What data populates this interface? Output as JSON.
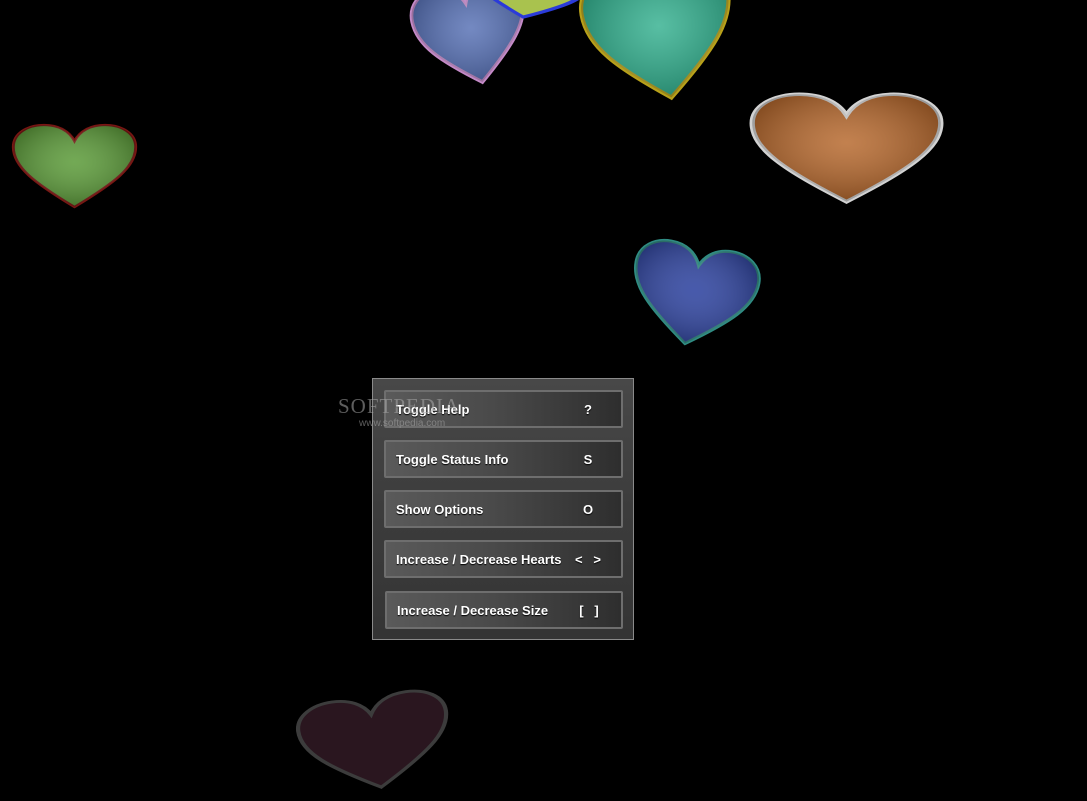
{
  "background_color": "#000000",
  "help_menu": {
    "items": [
      {
        "label": "Toggle Help",
        "key": "?"
      },
      {
        "label": "Toggle Status Info",
        "key": "S"
      },
      {
        "label": "Show Options",
        "key": "O"
      },
      {
        "label": "Increase / Decrease Hearts",
        "key": "<   >"
      },
      {
        "label": "Increase / Decrease Size",
        "key": "[   ]"
      }
    ]
  },
  "watermark": {
    "logo": "SOFTPEDIA",
    "url": "www.softpedia.com"
  },
  "hearts": [
    {
      "fill": "#556fb4",
      "stroke": "#c48ac8"
    },
    {
      "fill": "#a9c24e",
      "stroke": "#2b3bd9"
    },
    {
      "fill": "#2eae8c",
      "stroke": "#b8a11a"
    },
    {
      "fill": "#5a9a37",
      "stroke": "#7a1612"
    },
    {
      "fill": "#b56528",
      "stroke": "#d2d2d2"
    },
    {
      "fill": "#2f44a0",
      "stroke": "#2f8c83"
    },
    {
      "fill": "#2a161f",
      "stroke": "#3c3c3c"
    }
  ]
}
